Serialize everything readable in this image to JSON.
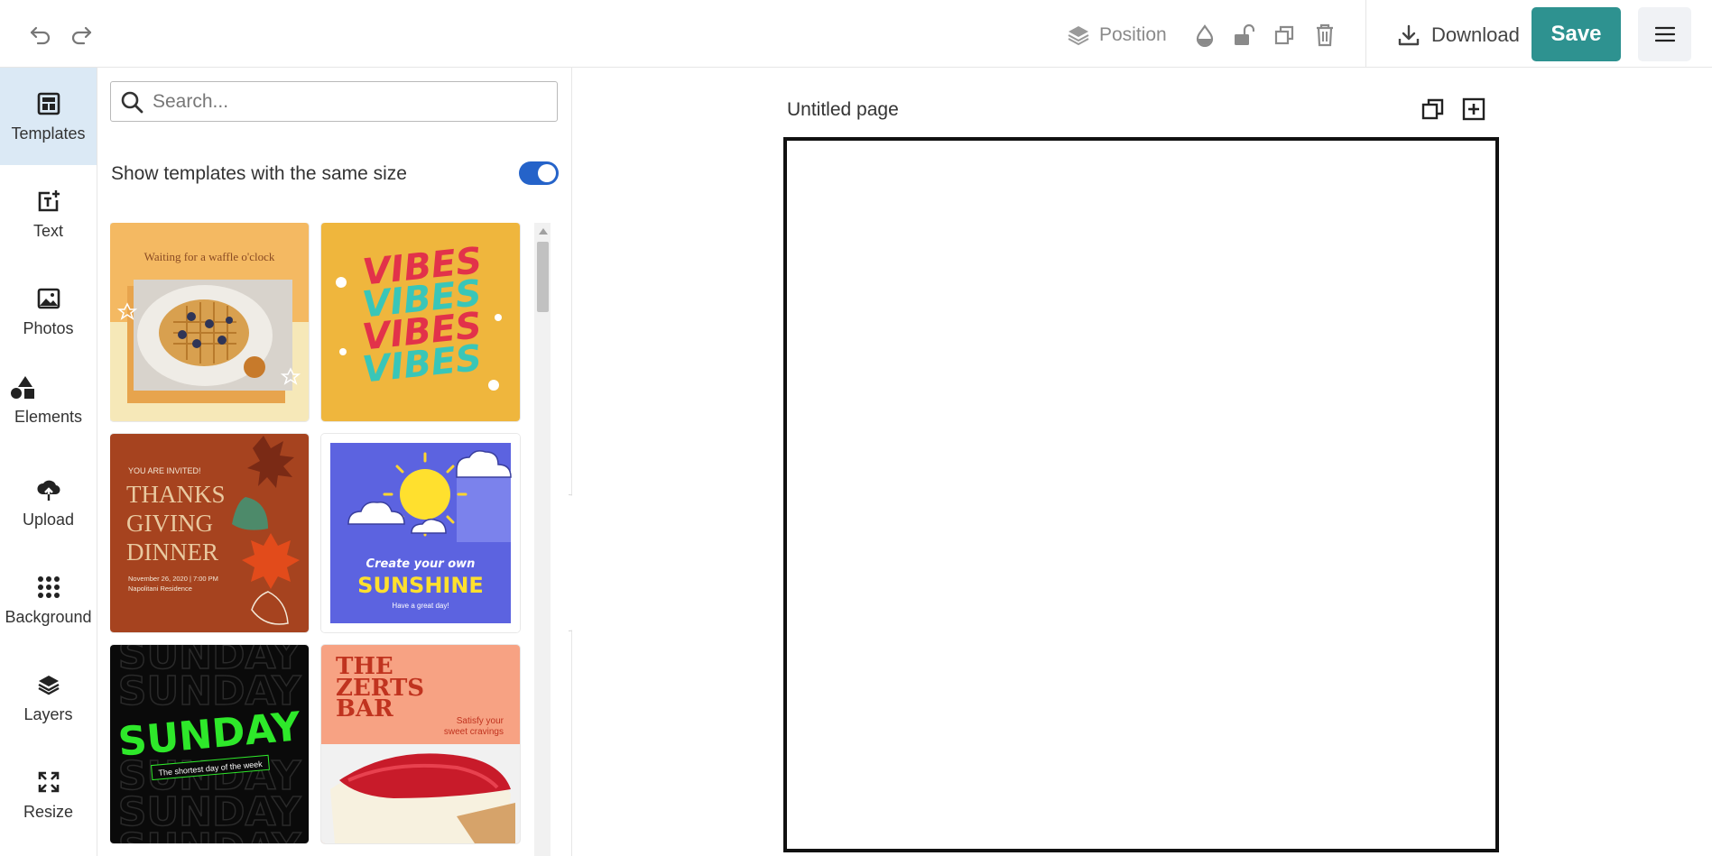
{
  "toolbar": {
    "undo_icon": "undo-icon",
    "redo_icon": "redo-icon",
    "position_label": "Position",
    "download_label": "Download",
    "save_label": "Save"
  },
  "rail": {
    "items": [
      {
        "label": "Templates",
        "icon": "templates-icon"
      },
      {
        "label": "Text",
        "icon": "text-icon"
      },
      {
        "label": "Photos",
        "icon": "photos-icon"
      },
      {
        "label": "Elements",
        "icon": "shapes-icon"
      },
      {
        "label": "Upload",
        "icon": "upload-icon"
      },
      {
        "label": "Background",
        "icon": "dots-grid-icon"
      },
      {
        "label": "Layers",
        "icon": "layers-icon"
      },
      {
        "label": "Resize",
        "icon": "resize-icon"
      }
    ]
  },
  "panel": {
    "search_placeholder": "Search...",
    "same_size_label": "Show templates with the same size",
    "same_size_on": true,
    "templates": {
      "waffle": {
        "line1": "Waiting for a waffle o'clock"
      },
      "vibes": {
        "word": "VIBES"
      },
      "thanks": {
        "invite": "YOU ARE INVITED!",
        "l1": "THANKS",
        "l2": "GIVING",
        "l3": "DINNER",
        "date": "November 26, 2020 | 7:00 PM",
        "place": "Napolitani Residence"
      },
      "sunshine": {
        "line1": "Create your own",
        "line2": "SUNSHINE",
        "line3": "Have a great day!"
      },
      "sunday": {
        "word": "SUNDAY",
        "tagline": "The shortest day of the week"
      },
      "zerts": {
        "l1": "THE",
        "l2": "ZERTS",
        "l3": "BAR",
        "tag1": "Satisfy your",
        "tag2": "sweet cravings"
      }
    }
  },
  "canvas": {
    "page_title": "Untitled page"
  },
  "colors": {
    "save": "#2e9290",
    "rail_active": "#dbe9f5",
    "toggle": "#2563c9"
  }
}
